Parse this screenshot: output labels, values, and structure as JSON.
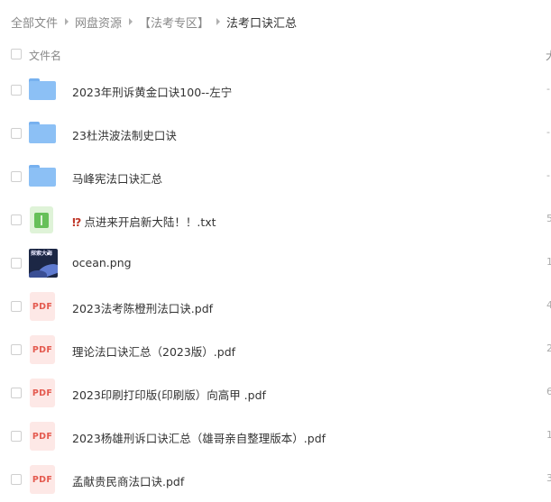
{
  "breadcrumb": {
    "items": [
      "全部文件",
      "网盘资源",
      "【法考专区】",
      "法考口诀汇总"
    ]
  },
  "header": {
    "name_label": "文件名",
    "right_col": "大"
  },
  "files": [
    {
      "type": "folder",
      "name": "2023年刑诉黄金口诀100--左宁",
      "edge": "-"
    },
    {
      "type": "folder",
      "name": "23杜洪波法制史口诀",
      "edge": "-"
    },
    {
      "type": "folder",
      "name": "马峰宪法口诀汇总",
      "edge": "-"
    },
    {
      "type": "txt",
      "emoji": "⁉",
      "name": "点进来开启新大陆！！.txt",
      "edge": "5"
    },
    {
      "type": "image",
      "name": "ocean.png",
      "edge": "1"
    },
    {
      "type": "pdf",
      "name": "2023法考陈橙刑法口诀.pdf",
      "edge": "4"
    },
    {
      "type": "pdf",
      "name": "理论法口诀汇总（2023版）.pdf",
      "edge": "2"
    },
    {
      "type": "pdf",
      "name": "2023印刷打印版(印刷版）向高甲 .pdf",
      "edge": "6"
    },
    {
      "type": "pdf",
      "name": "2023杨雄刑诉口诀汇总（雄哥亲自整理版本）.pdf",
      "edge": "1"
    },
    {
      "type": "pdf",
      "name": "孟献贵民商法口诀.pdf",
      "edge": "3"
    }
  ],
  "icons": {
    "pdf_label": "PDF",
    "thumb_text": "探索大海"
  },
  "colors": {
    "folder": "#8cc0f5",
    "pdf": "#e45a4f",
    "txt": "#67c05a"
  }
}
